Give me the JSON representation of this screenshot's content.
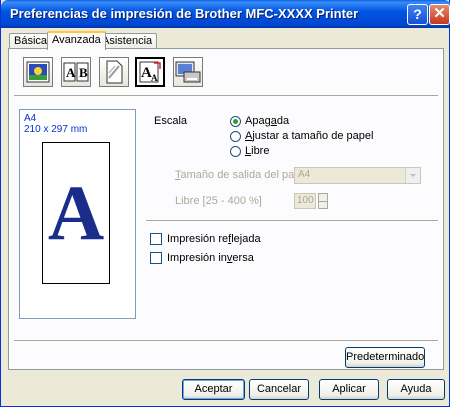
{
  "window": {
    "title": "Preferencias de impresión de Brother MFC-XXXX Printer",
    "help_glyph": "?",
    "close_glyph": "✕"
  },
  "tabs": [
    {
      "label": "Básica",
      "active": false
    },
    {
      "label": "Avanzada",
      "active": true
    },
    {
      "label": "Asistencia",
      "active": false
    }
  ],
  "toolbar": {
    "icons": [
      "print-quality-icon",
      "duplex-icon",
      "watermark-icon",
      "scaling-icon",
      "device-options-icon"
    ],
    "selected_index": 3
  },
  "preview": {
    "paper": "A4",
    "dimensions": "210 x 297 mm",
    "letter": "A"
  },
  "scaling": {
    "label": "Escala",
    "options": [
      {
        "text": "Apagada",
        "selected": true
      },
      {
        "text": "Ajustar a tamaño de papel",
        "selected": false
      },
      {
        "text": "Libre",
        "selected": false
      }
    ],
    "output_size_label": "Tamaño de salida del papel",
    "output_size_value": "A4",
    "free_label": "Libre [25 - 400 %]",
    "free_value": "100"
  },
  "options": {
    "mirror": {
      "label": "Impresión reflejada",
      "checked": false
    },
    "reverse": {
      "label": "Impresión inversa",
      "checked": false
    }
  },
  "buttons": {
    "default_settings": "Predeterminado",
    "accept": "Aceptar",
    "cancel": "Cancelar",
    "apply": "Aplicar",
    "help": "Ayuda"
  },
  "colors": {
    "title_bar": "#0055e5",
    "preview_text": "#0033cc",
    "preview_letter": "#1a2d8a",
    "disabled_text": "#aca899"
  }
}
